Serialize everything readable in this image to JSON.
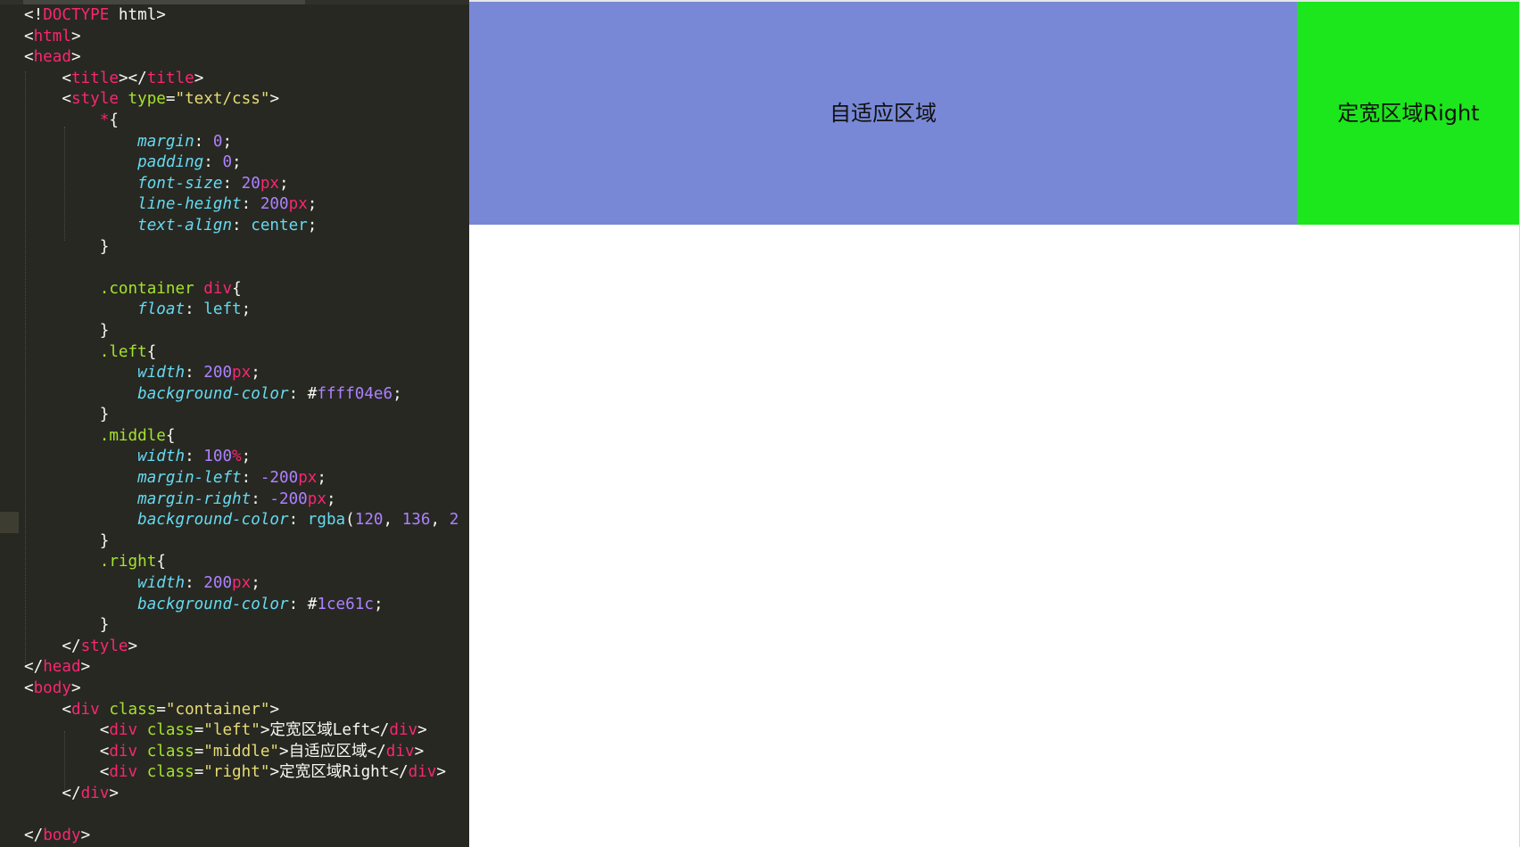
{
  "editor": {
    "lines": [
      [
        [
          "t-punc",
          "<!"
        ],
        [
          "t-tag",
          "DOCTYPE"
        ],
        [
          "t-punc",
          " html>"
        ]
      ],
      [
        [
          "t-punc",
          "<"
        ],
        [
          "t-tag",
          "html"
        ],
        [
          "t-punc",
          ">"
        ]
      ],
      [
        [
          "t-punc",
          "<"
        ],
        [
          "t-tag",
          "head"
        ],
        [
          "t-punc",
          ">"
        ]
      ],
      [
        [
          "t-punc",
          "    <"
        ],
        [
          "t-tag",
          "title"
        ],
        [
          "t-punc",
          "></"
        ],
        [
          "t-tag",
          "title"
        ],
        [
          "t-punc",
          ">"
        ]
      ],
      [
        [
          "t-punc",
          "    <"
        ],
        [
          "t-tag",
          "style"
        ],
        [
          "t-punc",
          " "
        ],
        [
          "t-attr",
          "type"
        ],
        [
          "t-punc",
          "="
        ],
        [
          "t-str",
          "\"text/css\""
        ],
        [
          "t-punc",
          ">"
        ]
      ],
      [
        [
          "t-punc",
          "        "
        ],
        [
          "t-tag",
          "*"
        ],
        [
          "t-punc",
          "{"
        ]
      ],
      [
        [
          "t-punc",
          "            "
        ],
        [
          "t-prop",
          "margin"
        ],
        [
          "t-punc",
          ": "
        ],
        [
          "t-num",
          "0"
        ],
        [
          "t-punc",
          ";"
        ]
      ],
      [
        [
          "t-punc",
          "            "
        ],
        [
          "t-prop",
          "padding"
        ],
        [
          "t-punc",
          ": "
        ],
        [
          "t-num",
          "0"
        ],
        [
          "t-punc",
          ";"
        ]
      ],
      [
        [
          "t-punc",
          "            "
        ],
        [
          "t-prop",
          "font-size"
        ],
        [
          "t-punc",
          ": "
        ],
        [
          "t-num",
          "20"
        ],
        [
          "t-unit",
          "px"
        ],
        [
          "t-punc",
          ";"
        ]
      ],
      [
        [
          "t-punc",
          "            "
        ],
        [
          "t-prop",
          "line-height"
        ],
        [
          "t-punc",
          ": "
        ],
        [
          "t-num",
          "200"
        ],
        [
          "t-unit",
          "px"
        ],
        [
          "t-punc",
          ";"
        ]
      ],
      [
        [
          "t-punc",
          "            "
        ],
        [
          "t-prop",
          "text-align"
        ],
        [
          "t-punc",
          ": "
        ],
        [
          "t-val",
          "center"
        ],
        [
          "t-punc",
          ";"
        ]
      ],
      [
        [
          "t-punc",
          "        }"
        ]
      ],
      [
        [
          "t-punc",
          ""
        ]
      ],
      [
        [
          "t-punc",
          "        "
        ],
        [
          "t-sel",
          ".container"
        ],
        [
          "t-punc",
          " "
        ],
        [
          "t-tag",
          "div"
        ],
        [
          "t-punc",
          "{"
        ]
      ],
      [
        [
          "t-punc",
          "            "
        ],
        [
          "t-prop",
          "float"
        ],
        [
          "t-punc",
          ": "
        ],
        [
          "t-val",
          "left"
        ],
        [
          "t-punc",
          ";"
        ]
      ],
      [
        [
          "t-punc",
          "        }"
        ]
      ],
      [
        [
          "t-punc",
          "        "
        ],
        [
          "t-sel",
          ".left"
        ],
        [
          "t-punc",
          "{"
        ]
      ],
      [
        [
          "t-punc",
          "            "
        ],
        [
          "t-prop",
          "width"
        ],
        [
          "t-punc",
          ": "
        ],
        [
          "t-num",
          "200"
        ],
        [
          "t-unit",
          "px"
        ],
        [
          "t-punc",
          ";"
        ]
      ],
      [
        [
          "t-punc",
          "            "
        ],
        [
          "t-prop",
          "background-color"
        ],
        [
          "t-punc",
          ": #"
        ],
        [
          "t-num",
          "ffff04e6"
        ],
        [
          "t-punc",
          ";"
        ]
      ],
      [
        [
          "t-punc",
          "        }"
        ]
      ],
      [
        [
          "t-punc",
          "        "
        ],
        [
          "t-sel",
          ".middle"
        ],
        [
          "t-punc",
          "{"
        ]
      ],
      [
        [
          "t-punc",
          "            "
        ],
        [
          "t-prop",
          "width"
        ],
        [
          "t-punc",
          ": "
        ],
        [
          "t-num",
          "100"
        ],
        [
          "t-unit",
          "%"
        ],
        [
          "t-punc",
          ";"
        ]
      ],
      [
        [
          "t-punc",
          "            "
        ],
        [
          "t-prop",
          "margin-left"
        ],
        [
          "t-punc",
          ": "
        ],
        [
          "t-num",
          "-200"
        ],
        [
          "t-unit",
          "px"
        ],
        [
          "t-punc",
          ";"
        ]
      ],
      [
        [
          "t-punc",
          "            "
        ],
        [
          "t-prop",
          "margin-right"
        ],
        [
          "t-punc",
          ": "
        ],
        [
          "t-num",
          "-200"
        ],
        [
          "t-unit",
          "px"
        ],
        [
          "t-punc",
          ";"
        ]
      ],
      [
        [
          "t-punc",
          "            "
        ],
        [
          "t-prop",
          "background-color"
        ],
        [
          "t-punc",
          ": "
        ],
        [
          "t-val",
          "rgba"
        ],
        [
          "t-punc",
          "("
        ],
        [
          "t-num",
          "120"
        ],
        [
          "t-punc",
          ", "
        ],
        [
          "t-num",
          "136"
        ],
        [
          "t-punc",
          ", "
        ],
        [
          "t-num",
          "2"
        ]
      ],
      [
        [
          "t-punc",
          "        }"
        ]
      ],
      [
        [
          "t-punc",
          "        "
        ],
        [
          "t-sel",
          ".right"
        ],
        [
          "t-punc",
          "{"
        ]
      ],
      [
        [
          "t-punc",
          "            "
        ],
        [
          "t-prop",
          "width"
        ],
        [
          "t-punc",
          ": "
        ],
        [
          "t-num",
          "200"
        ],
        [
          "t-unit",
          "px"
        ],
        [
          "t-punc",
          ";"
        ]
      ],
      [
        [
          "t-punc",
          "            "
        ],
        [
          "t-prop",
          "background-color"
        ],
        [
          "t-punc",
          ": #"
        ],
        [
          "t-num",
          "1ce61c"
        ],
        [
          "t-punc",
          ";"
        ]
      ],
      [
        [
          "t-punc",
          "        }"
        ]
      ],
      [
        [
          "t-punc",
          "    </"
        ],
        [
          "t-tag",
          "style"
        ],
        [
          "t-punc",
          ">"
        ]
      ],
      [
        [
          "t-punc",
          "</"
        ],
        [
          "t-tag",
          "head"
        ],
        [
          "t-punc",
          ">"
        ]
      ],
      [
        [
          "t-punc",
          "<"
        ],
        [
          "t-tag",
          "body"
        ],
        [
          "t-punc",
          ">"
        ]
      ],
      [
        [
          "t-punc",
          "    <"
        ],
        [
          "t-tag",
          "div"
        ],
        [
          "t-punc",
          " "
        ],
        [
          "t-attr",
          "class"
        ],
        [
          "t-punc",
          "="
        ],
        [
          "t-str",
          "\"container\""
        ],
        [
          "t-punc",
          ">"
        ]
      ],
      [
        [
          "t-punc",
          "        <"
        ],
        [
          "t-tag",
          "div"
        ],
        [
          "t-punc",
          " "
        ],
        [
          "t-attr",
          "class"
        ],
        [
          "t-punc",
          "="
        ],
        [
          "t-str",
          "\"left\""
        ],
        [
          "t-punc",
          ">定宽区域Left</"
        ],
        [
          "t-tag",
          "div"
        ],
        [
          "t-punc",
          ">"
        ]
      ],
      [
        [
          "t-punc",
          "        <"
        ],
        [
          "t-tag",
          "div"
        ],
        [
          "t-punc",
          " "
        ],
        [
          "t-attr",
          "class"
        ],
        [
          "t-punc",
          "="
        ],
        [
          "t-str",
          "\"middle\""
        ],
        [
          "t-punc",
          ">自适应区域</"
        ],
        [
          "t-tag",
          "div"
        ],
        [
          "t-punc",
          ">"
        ]
      ],
      [
        [
          "t-punc",
          "        <"
        ],
        [
          "t-tag",
          "div"
        ],
        [
          "t-punc",
          " "
        ],
        [
          "t-attr",
          "class"
        ],
        [
          "t-punc",
          "="
        ],
        [
          "t-str",
          "\"right\""
        ],
        [
          "t-punc",
          ">定宽区域Right</"
        ],
        [
          "t-tag",
          "div"
        ],
        [
          "t-punc",
          ">"
        ]
      ],
      [
        [
          "t-punc",
          "    </"
        ],
        [
          "t-tag",
          "div"
        ],
        [
          "t-punc",
          ">"
        ]
      ],
      [
        [
          "t-punc",
          ""
        ]
      ],
      [
        [
          "t-punc",
          "</"
        ],
        [
          "t-tag",
          "body"
        ],
        [
          "t-punc",
          ">"
        ]
      ]
    ]
  },
  "preview": {
    "middle_label": "自适应区域",
    "right_label": "定宽区域Right",
    "middle_color": "#7888d6",
    "right_color": "#1ce61c"
  }
}
